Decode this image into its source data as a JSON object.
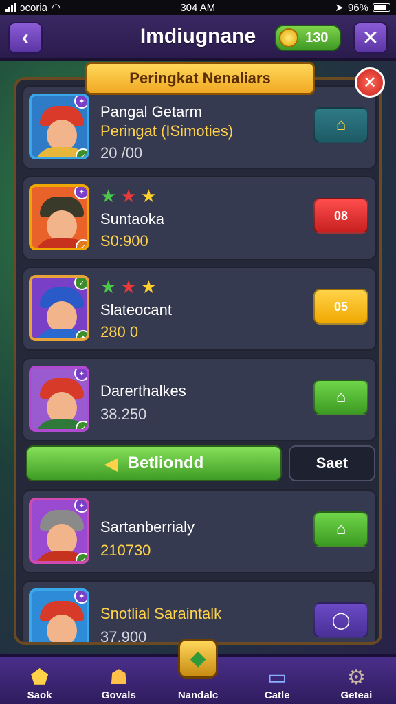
{
  "status_bar": {
    "carrier": "ɔcoria",
    "time": "304 AM",
    "battery": "96%"
  },
  "header": {
    "back_icon": "chevron-left-icon",
    "title": "Imdiugnane",
    "coins": "130",
    "close_icon": "close-icon"
  },
  "panel": {
    "banner_title": "Peringkat Nenaliars",
    "rows": [
      {
        "name": "Pangal Getarm",
        "subtitle": "Peringat (ISimoties)",
        "score": "20 /00",
        "action_icon": "house-icon",
        "action_label": ""
      },
      {
        "name": "Suntaoka",
        "score": "S0:900",
        "action_label": "08",
        "stars": 3
      },
      {
        "name": "Slateocant",
        "score": "280 0",
        "action_label": "05",
        "stars": 3
      },
      {
        "name": "Darerthalkes",
        "score": "38.250",
        "action_icon": "house-icon",
        "action_label": ""
      }
    ],
    "bottom_rows": [
      {
        "name": "Sartanberrialy",
        "score": "210730",
        "action_icon": "house-icon",
        "action_label": ""
      },
      {
        "name": "Snotlial Saraintalk",
        "score": "37.900",
        "action_icon": "search-icon",
        "action_label": ""
      }
    ],
    "primary_button": "Betliondd",
    "secondary_button": "Saet"
  },
  "bottom_nav": [
    {
      "label": "Saok",
      "icon": "shield-icon"
    },
    {
      "label": "Govals",
      "icon": "cat-icon"
    },
    {
      "label": "Nandalc",
      "icon": "map-icon"
    },
    {
      "label": "Catle",
      "icon": "controller-icon"
    },
    {
      "label": "Geteai",
      "icon": "gear-icon"
    }
  ]
}
